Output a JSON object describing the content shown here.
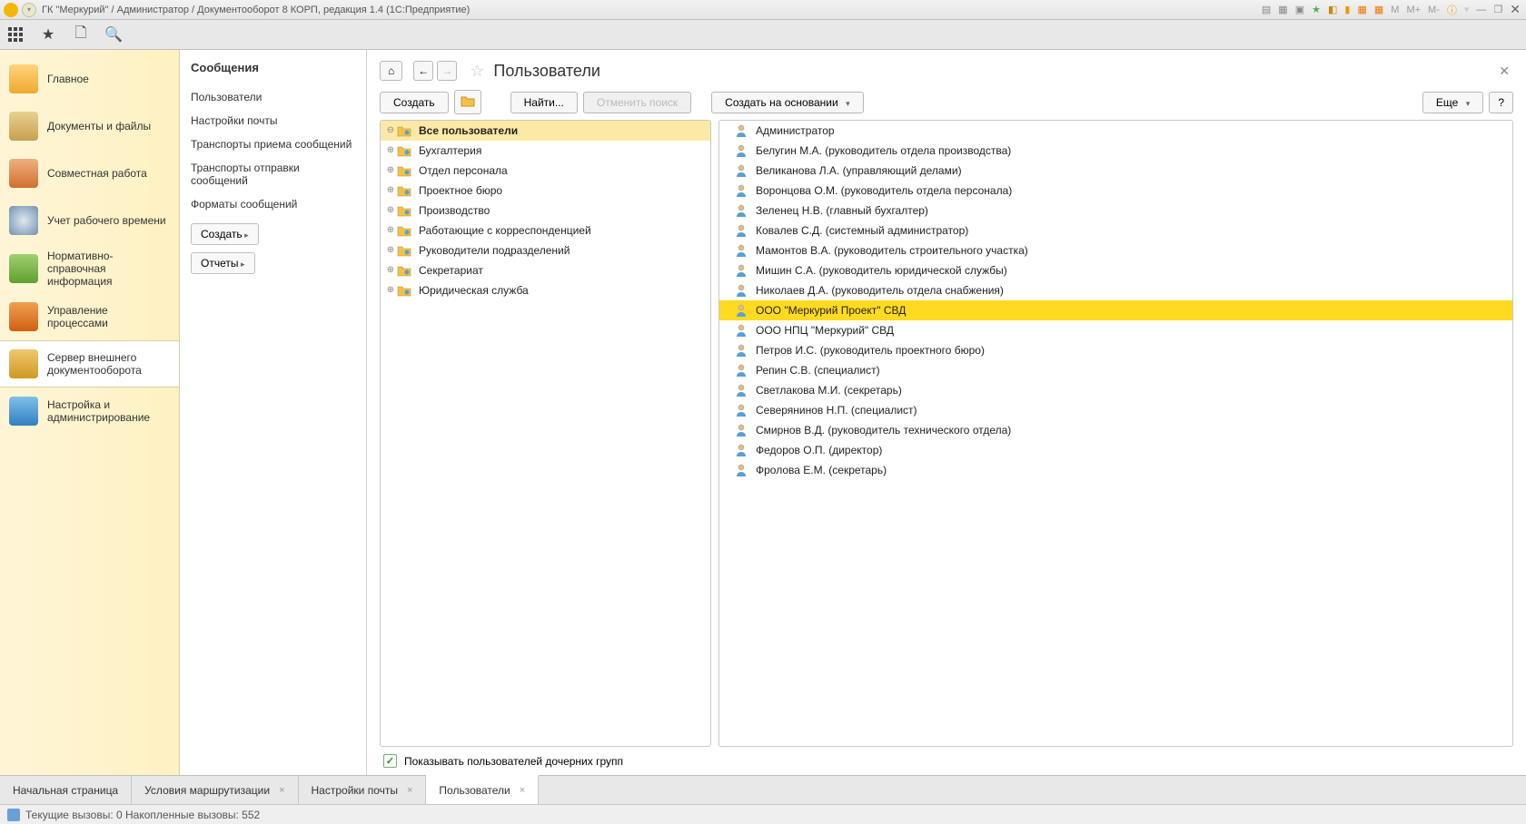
{
  "window": {
    "title": "ГК \"Меркурий\" / Администратор / Документооборот 8 КОРП, редакция 1.4  (1С:Предприятие)",
    "sys_m": "M",
    "sys_mp": "M+",
    "sys_mm": "M-"
  },
  "nav": [
    {
      "label": "Главное"
    },
    {
      "label": "Документы и файлы"
    },
    {
      "label": "Совместная работа"
    },
    {
      "label": "Учет рабочего времени"
    },
    {
      "label": "Нормативно-справочная информация"
    },
    {
      "label": "Управление процессами"
    },
    {
      "label": "Сервер внешнего документооборота"
    },
    {
      "label": "Настройка и администрирование"
    }
  ],
  "subnav": {
    "title": "Сообщения",
    "links": [
      "Пользователи",
      "Настройки почты",
      "Транспорты приема сообщений",
      "Транспорты отправки сообщений",
      "Форматы сообщений"
    ],
    "btn_create": "Создать",
    "btn_reports": "Отчеты"
  },
  "page": {
    "title": "Пользователи",
    "toolbar": {
      "create": "Создать",
      "find": "Найти...",
      "cancel_find": "Отменить поиск",
      "create_based": "Создать на основании",
      "more": "Еще",
      "help": "?"
    },
    "groups": [
      {
        "label": "Все пользователи",
        "selected": true
      },
      {
        "label": "Бухгалтерия"
      },
      {
        "label": "Отдел персонала"
      },
      {
        "label": "Проектное бюро"
      },
      {
        "label": "Производство"
      },
      {
        "label": "Работающие с корреспонденцией"
      },
      {
        "label": "Руководители подразделений"
      },
      {
        "label": "Секретариат"
      },
      {
        "label": "Юридическая служба"
      }
    ],
    "users": [
      {
        "label": "Администратор"
      },
      {
        "label": "Белугин М.А. (руководитель отдела производства)"
      },
      {
        "label": "Великанова Л.А. (управляющий делами)"
      },
      {
        "label": "Воронцова О.М. (руководитель отдела персонала)"
      },
      {
        "label": "Зеленец Н.В. (главный бухгалтер)"
      },
      {
        "label": "Ковалев С.Д. (системный администратор)"
      },
      {
        "label": "Мамонтов В.А. (руководитель строительного участка)"
      },
      {
        "label": "Мишин С.А. (руководитель юридической службы)"
      },
      {
        "label": "Николаев Д.А. (руководитель отдела снабжения)"
      },
      {
        "label": "ООО \"Меркурий Проект\" СВД",
        "selected": true
      },
      {
        "label": "ООО НПЦ \"Меркурий\" СВД"
      },
      {
        "label": "Петров И.С. (руководитель проектного бюро)"
      },
      {
        "label": "Репин С.В. (специалист)"
      },
      {
        "label": "Светлакова М.И. (секретарь)"
      },
      {
        "label": "Северянинов Н.П. (специалист)"
      },
      {
        "label": "Смирнов В.Д. (руководитель технического отдела)"
      },
      {
        "label": "Федоров О.П. (директор)"
      },
      {
        "label": "Фролова Е.М. (секретарь)"
      }
    ],
    "show_children": "Показывать пользователей дочерних групп"
  },
  "tabs": [
    {
      "label": "Начальная страница",
      "closable": false
    },
    {
      "label": "Условия маршрутизации",
      "closable": true
    },
    {
      "label": "Настройки почты",
      "closable": true
    },
    {
      "label": "Пользователи",
      "closable": true,
      "active": true
    }
  ],
  "status": "Текущие вызовы: 0  Накопленные вызовы: 552"
}
